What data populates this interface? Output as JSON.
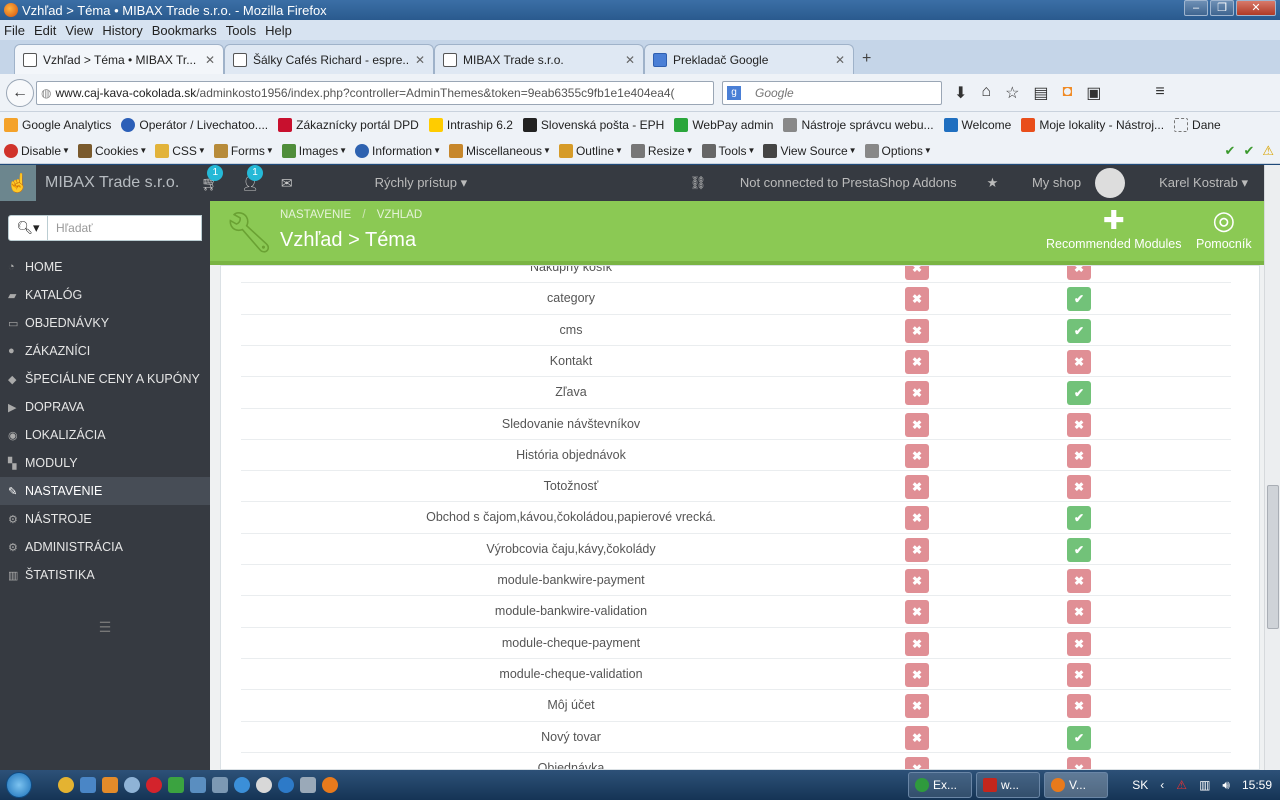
{
  "window": {
    "title": "Vzhľad > Téma • MIBAX Trade s.r.o. - Mozilla Firefox"
  },
  "menubar": [
    "File",
    "Edit",
    "View",
    "History",
    "Bookmarks",
    "Tools",
    "Help"
  ],
  "tabs": [
    {
      "label": "Vzhľad > Téma • MIBAX Tr...",
      "active": true
    },
    {
      "label": "Šálky Cafés Richard - espre...",
      "active": false
    },
    {
      "label": "MIBAX Trade s.r.o.",
      "active": false
    },
    {
      "label": "Prekladač Google",
      "active": false
    }
  ],
  "url": {
    "host": "www.caj-kava-cokolada.sk",
    "path": "/adminkosto1956/index.php?controller=AdminThemes&token=9eab6355c9fb1e1e404ea4("
  },
  "search": {
    "placeholder": "Google"
  },
  "bookmarks": [
    {
      "label": "Google Analytics",
      "color": "#f4a22a"
    },
    {
      "label": "Operátor / Livechatoo....",
      "color": "#2b5fb8"
    },
    {
      "label": "Zákaznícky portál DPD",
      "color": "#c8102e"
    },
    {
      "label": "Intraship 6.2",
      "color": "#ffcc00"
    },
    {
      "label": "Slovenská pošta - EPH",
      "color": "#222222"
    },
    {
      "label": "WebPay admin",
      "color": "#2aa63b"
    },
    {
      "label": "Nástroje správcu webu...",
      "color": "#888888"
    },
    {
      "label": "Welcome",
      "color": "#1f6fc0"
    },
    {
      "label": "Moje lokality - Nástroj...",
      "color": "#e94e1b"
    },
    {
      "label": "Dane",
      "color": "#dddddd"
    }
  ],
  "devbar": [
    {
      "label": "Disable",
      "color": "#d0332b"
    },
    {
      "label": "Cookies",
      "color": "#7a5a2d"
    },
    {
      "label": "CSS",
      "color": "#e2b33a"
    },
    {
      "label": "Forms",
      "color": "#b78b3a"
    },
    {
      "label": "Images",
      "color": "#4f8d3a"
    },
    {
      "label": "Information",
      "color": "#2e62b0"
    },
    {
      "label": "Miscellaneous",
      "color": "#c7872b"
    },
    {
      "label": "Outline",
      "color": "#d69b28"
    },
    {
      "label": "Resize",
      "color": "#777777"
    },
    {
      "label": "Tools",
      "color": "#666666"
    },
    {
      "label": "View Source",
      "color": "#444444"
    },
    {
      "label": "Options",
      "color": "#888888"
    }
  ],
  "header": {
    "shop_name": "MIBAX Trade s.r.o.",
    "cart_badge": "1",
    "customers_badge": "1",
    "quick_access": "Rýchly prístup",
    "addons": "Not connected to PrestaShop Addons",
    "my_shop": "My shop",
    "user": "Karel Kostrab"
  },
  "sidebar": {
    "search_placeholder": "Hľadať",
    "items": [
      {
        "label": "HOME",
        "icon": "dashboard-icon",
        "active": false
      },
      {
        "label": "KATALÓG",
        "icon": "book-icon",
        "active": false
      },
      {
        "label": "OBJEDNÁVKY",
        "icon": "credit-card-icon",
        "active": false
      },
      {
        "label": "ZÁKAZNÍCI",
        "icon": "users-icon",
        "active": false
      },
      {
        "label": "ŠPECIÁLNE CENY A KUPÓNY",
        "icon": "tag-icon",
        "active": false
      },
      {
        "label": "DOPRAVA",
        "icon": "truck-icon",
        "active": false
      },
      {
        "label": "LOKALIZÁCIA",
        "icon": "globe-icon",
        "active": false
      },
      {
        "label": "MODULY",
        "icon": "puzzle-icon",
        "active": false
      },
      {
        "label": "NASTAVENIE",
        "icon": "wrench-icon",
        "active": true
      },
      {
        "label": "NÁSTROJE",
        "icon": "cogs-icon",
        "active": false
      },
      {
        "label": "ADMINISTRÁCIA",
        "icon": "cog-icon",
        "active": false
      },
      {
        "label": "ŠTATISTIKA",
        "icon": "bar-chart-icon",
        "active": false
      }
    ]
  },
  "toolbar": {
    "breadcrumb": [
      "NASTAVENIE",
      "VZHLAD"
    ],
    "title": "Vzhľad > Téma",
    "recommended": "Recommended Modules",
    "help": "Pomocník"
  },
  "table": {
    "rows": [
      {
        "name": "Nákupný košík",
        "col1": false,
        "col2": false
      },
      {
        "name": "category",
        "col1": false,
        "col2": true
      },
      {
        "name": "cms",
        "col1": false,
        "col2": true
      },
      {
        "name": "Kontakt",
        "col1": false,
        "col2": false
      },
      {
        "name": "Zľava",
        "col1": false,
        "col2": true
      },
      {
        "name": "Sledovanie návštevníkov",
        "col1": false,
        "col2": false
      },
      {
        "name": "História objednávok",
        "col1": false,
        "col2": false
      },
      {
        "name": "Totožnosť",
        "col1": false,
        "col2": false
      },
      {
        "name": "Obchod s čajom,kávou,čokoládou,papierové vrecká.",
        "col1": false,
        "col2": true
      },
      {
        "name": "Výrobcovia čaju,kávy,čokolády",
        "col1": false,
        "col2": true
      },
      {
        "name": "module-bankwire-payment",
        "col1": false,
        "col2": false
      },
      {
        "name": "module-bankwire-validation",
        "col1": false,
        "col2": false
      },
      {
        "name": "module-cheque-payment",
        "col1": false,
        "col2": false
      },
      {
        "name": "module-cheque-validation",
        "col1": false,
        "col2": false
      },
      {
        "name": "Môj účet",
        "col1": false,
        "col2": false
      },
      {
        "name": "Nový tovar",
        "col1": false,
        "col2": true
      },
      {
        "name": "Objednávka",
        "col1": false,
        "col2": false
      }
    ]
  },
  "taskbar": {
    "tasks": [
      {
        "label": "Ex...",
        "color": "#2f9a3d"
      },
      {
        "label": "w...",
        "color": "#c4261d"
      },
      {
        "label": "V...",
        "color": "#e87a1c"
      }
    ],
    "lang": "SK",
    "time": "15:59"
  },
  "colors": {
    "ps_dark": "#363a41",
    "ps_green": "#8bc954",
    "no": "#e08f95",
    "yes": "#72c279"
  }
}
